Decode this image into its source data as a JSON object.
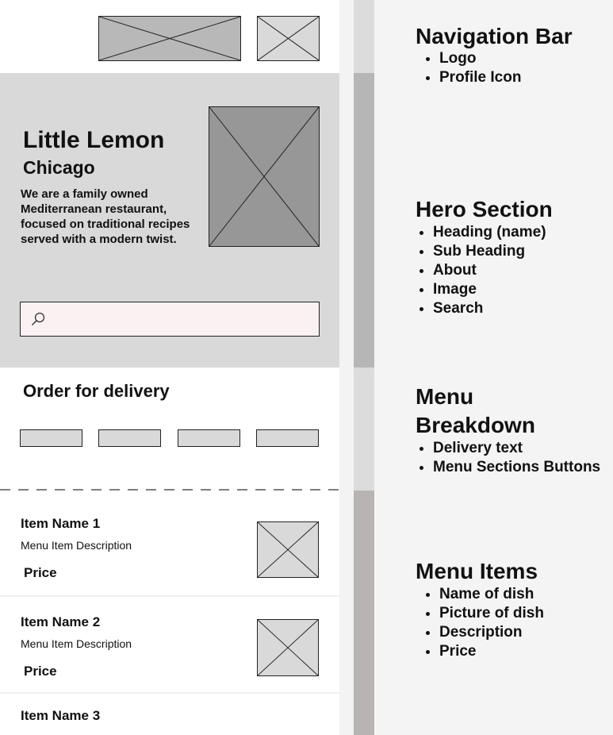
{
  "wireframe": {
    "hero": {
      "title": "Little Lemon",
      "subtitle": "Chicago",
      "about": "We are a family owned Mediterranean restaurant, focused on traditional recipes served with a modern twist."
    },
    "search": {
      "placeholder": ""
    },
    "order": {
      "title": "Order for delivery"
    },
    "menu_items": [
      {
        "name": "Item Name 1",
        "description": "Menu Item Description",
        "price": "Price"
      },
      {
        "name": "Item Name 2",
        "description": "Menu Item Description",
        "price": "Price"
      },
      {
        "name": "Item Name 3"
      }
    ]
  },
  "annotations": [
    {
      "title": "Navigation Bar",
      "items": [
        "Logo",
        "Profile Icon"
      ]
    },
    {
      "title": "Hero Section",
      "items": [
        "Heading (name)",
        "Sub Heading",
        "About",
        "Image",
        "Search"
      ]
    },
    {
      "title": "Menu Breakdown",
      "items": [
        "Delivery text",
        "Menu Sections Buttons"
      ]
    },
    {
      "title": "Menu Items",
      "items": [
        "Name of dish",
        "Picture of dish",
        "Description",
        "Price"
      ]
    }
  ],
  "colors": {
    "hero_bg": "#d9d9d9",
    "placeholder_dark": "#979797",
    "placeholder_mid": "#b9b8b8",
    "placeholder_light": "#d9d9d9",
    "search_bg": "#fbf1f2",
    "panel_bg": "#f4f4f4",
    "band_nav": "#dcdcdc",
    "band_hero": "#b7b6b6",
    "band_menu": "#dcdcdc",
    "band_items": "#b9b4b4"
  },
  "icons": {
    "search": "search-icon"
  }
}
